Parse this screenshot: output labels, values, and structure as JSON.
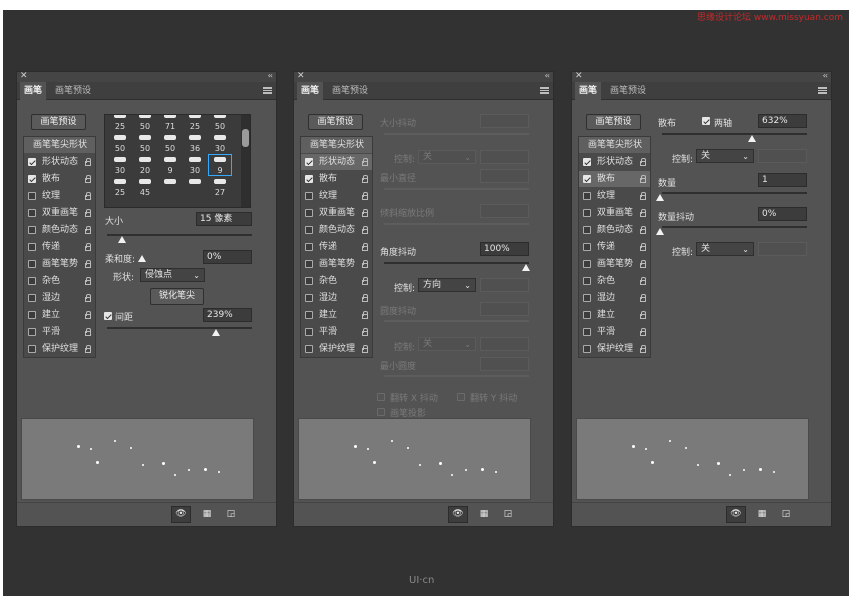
{
  "watermark": "思缘设计论坛  www.missyuan.com",
  "logo": "UI·cn",
  "p1": {
    "tab_brush": "画笔",
    "tab_preset": "画笔预设",
    "preset_btn": "画笔预设",
    "items": [
      {
        "label": "画笔笔尖形状",
        "check": null,
        "lock": false
      },
      {
        "label": "形状动态",
        "check": true,
        "lock": true
      },
      {
        "label": "散布",
        "check": true,
        "lock": true
      },
      {
        "label": "纹理",
        "check": false,
        "lock": true
      },
      {
        "label": "双重画笔",
        "check": false,
        "lock": true
      },
      {
        "label": "颜色动态",
        "check": false,
        "lock": true
      },
      {
        "label": "传递",
        "check": false,
        "lock": true
      },
      {
        "label": "画笔笔势",
        "check": false,
        "lock": true
      },
      {
        "label": "杂色",
        "check": false,
        "lock": true
      },
      {
        "label": "湿边",
        "check": false,
        "lock": true
      },
      {
        "label": "建立",
        "check": false,
        "lock": true
      },
      {
        "label": "平滑",
        "check": false,
        "lock": true
      },
      {
        "label": "保护纹理",
        "check": false,
        "lock": true
      }
    ],
    "grid": [
      [
        "25",
        "50",
        "71",
        "25",
        "50"
      ],
      [
        "50",
        "50",
        "50",
        "36",
        "30"
      ],
      [
        "30",
        "20",
        "9",
        "30",
        "9"
      ],
      [
        "25",
        "45",
        "",
        "",
        "27"
      ]
    ],
    "size_label": "大小",
    "size_value": "15 像素",
    "hardness_label": "柔和度:",
    "hardness_value": "0%",
    "shape_label": "形状:",
    "shape_value": "侵蚀点",
    "sharpen_btn": "锐化笔尖",
    "spacing_label": "间距",
    "spacing_value": "239%"
  },
  "p2": {
    "tab_brush": "画笔",
    "tab_preset": "画笔预设",
    "preset_btn": "画笔预设",
    "items": [
      {
        "label": "画笔笔尖形状",
        "check": null,
        "lock": false
      },
      {
        "label": "形状动态",
        "check": true,
        "lock": true
      },
      {
        "label": "散布",
        "check": true,
        "lock": true
      },
      {
        "label": "纹理",
        "check": false,
        "lock": true
      },
      {
        "label": "双重画笔",
        "check": false,
        "lock": true
      },
      {
        "label": "颜色动态",
        "check": false,
        "lock": true
      },
      {
        "label": "传递",
        "check": false,
        "lock": true
      },
      {
        "label": "画笔笔势",
        "check": false,
        "lock": true
      },
      {
        "label": "杂色",
        "check": false,
        "lock": true
      },
      {
        "label": "湿边",
        "check": false,
        "lock": true
      },
      {
        "label": "建立",
        "check": false,
        "lock": true
      },
      {
        "label": "平滑",
        "check": false,
        "lock": true
      },
      {
        "label": "保护纹理",
        "check": false,
        "lock": true
      }
    ],
    "size_jitter": "大小抖动",
    "control": "控制:",
    "off": "关",
    "min_diameter": "最小直径",
    "tilt_scale": "倾斜缩放比例",
    "angle_jitter": "角度抖动",
    "angle_value": "100%",
    "direction": "方向",
    "roundness_jitter": "圆度抖动",
    "min_roundness": "最小圆度",
    "flip_x": "翻转 X 抖动",
    "flip_y": "翻转 Y 抖动",
    "brush_projection": "画笔投影"
  },
  "p3": {
    "tab_brush": "画笔",
    "tab_preset": "画笔预设",
    "preset_btn": "画笔预设",
    "items": [
      {
        "label": "画笔笔尖形状",
        "check": null,
        "lock": false
      },
      {
        "label": "形状动态",
        "check": true,
        "lock": true
      },
      {
        "label": "散布",
        "check": true,
        "lock": true
      },
      {
        "label": "纹理",
        "check": false,
        "lock": true
      },
      {
        "label": "双重画笔",
        "check": false,
        "lock": true
      },
      {
        "label": "颜色动态",
        "check": false,
        "lock": true
      },
      {
        "label": "传递",
        "check": false,
        "lock": true
      },
      {
        "label": "画笔笔势",
        "check": false,
        "lock": true
      },
      {
        "label": "杂色",
        "check": false,
        "lock": true
      },
      {
        "label": "湿边",
        "check": false,
        "lock": true
      },
      {
        "label": "建立",
        "check": false,
        "lock": true
      },
      {
        "label": "平滑",
        "check": false,
        "lock": true
      },
      {
        "label": "保护纹理",
        "check": false,
        "lock": true
      }
    ],
    "scatter": "散布",
    "both_axes": "两轴",
    "scatter_value": "632%",
    "control": "控制:",
    "off": "关",
    "count": "数量",
    "count_value": "1",
    "count_jitter": "数量抖动",
    "count_jitter_value": "0%",
    "control2": "控制:",
    "off2": "关"
  }
}
